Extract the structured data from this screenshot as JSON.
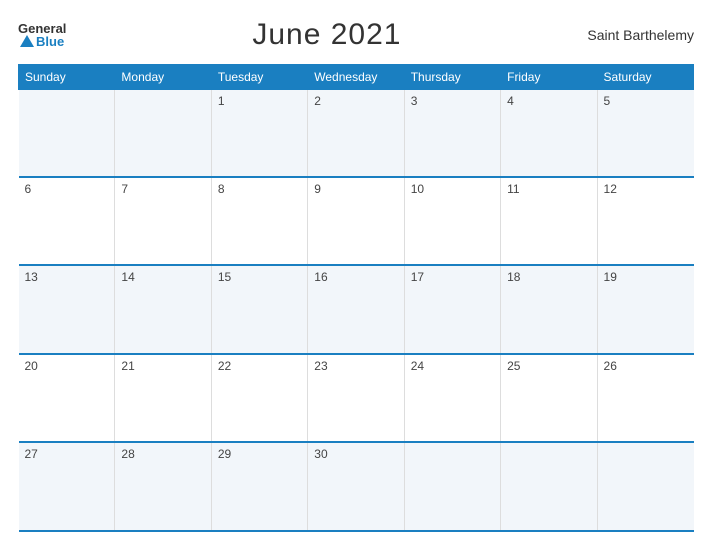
{
  "header": {
    "logo_general": "General",
    "logo_blue": "Blue",
    "title": "June 2021",
    "region": "Saint Barthelemy"
  },
  "days": [
    "Sunday",
    "Monday",
    "Tuesday",
    "Wednesday",
    "Thursday",
    "Friday",
    "Saturday"
  ],
  "weeks": [
    [
      "",
      "",
      "1",
      "2",
      "3",
      "4",
      "5"
    ],
    [
      "6",
      "7",
      "8",
      "9",
      "10",
      "11",
      "12"
    ],
    [
      "13",
      "14",
      "15",
      "16",
      "17",
      "18",
      "19"
    ],
    [
      "20",
      "21",
      "22",
      "23",
      "24",
      "25",
      "26"
    ],
    [
      "27",
      "28",
      "29",
      "30",
      "",
      "",
      ""
    ]
  ]
}
